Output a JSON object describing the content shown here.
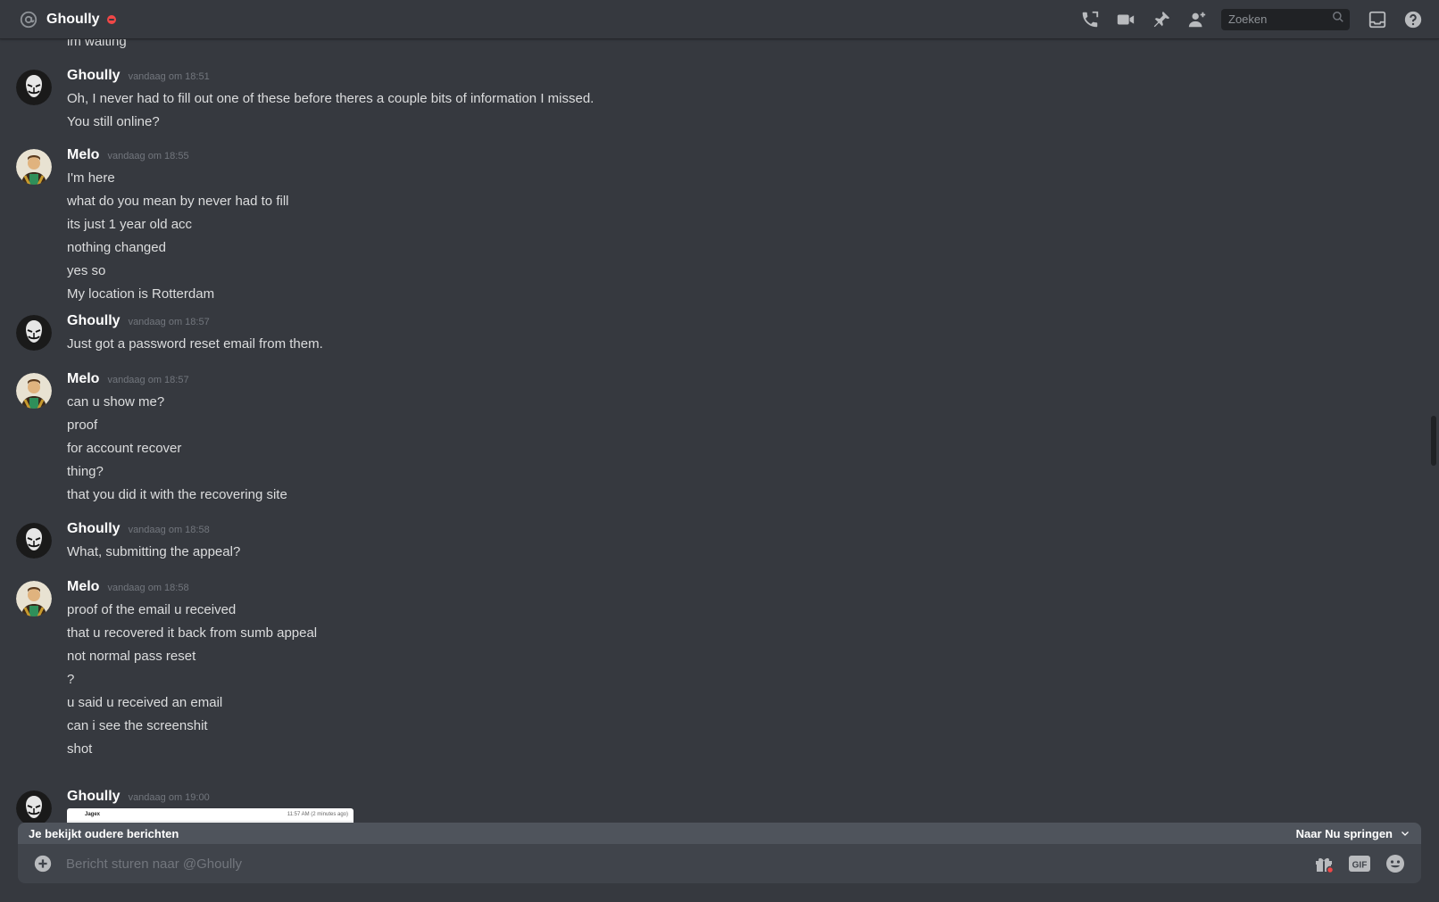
{
  "header": {
    "channel_name": "Ghoully",
    "status": "dnd",
    "search_placeholder": "Zoeken"
  },
  "icons": [
    "at-sign-icon",
    "phone-call-icon",
    "video-call-icon",
    "pin-icon",
    "add-friend-icon",
    "search-icon",
    "inbox-icon",
    "help-icon",
    "plus-circle-icon",
    "gift-icon",
    "gif-icon",
    "emoji-icon",
    "chevron-down-icon"
  ],
  "colors": {
    "background": "#36393f",
    "composer": "#40444b",
    "status_dnd": "#f04747",
    "banner": "#4f545c"
  },
  "messages": {
    "previous_line": "im waiting",
    "groups": [
      {
        "author": "Ghoully",
        "timestamp": "vandaag om 18:51",
        "lines": [
          "Oh, I never had to fill out one of these before theres a couple bits of information I missed.",
          "You still online?"
        ]
      },
      {
        "author": "Melo",
        "timestamp": "vandaag om 18:55",
        "lines": [
          "I'm here",
          "what do you mean by never had to fill",
          "its just 1 year old acc",
          "nothing changed",
          "yes so",
          "My location is Rotterdam"
        ]
      },
      {
        "author": "Ghoully",
        "timestamp": "vandaag om 18:57",
        "lines": [
          "Just got a password reset email from them."
        ]
      },
      {
        "author": "Melo",
        "timestamp": "vandaag om 18:57",
        "lines": [
          "can u show me?",
          "proof",
          "for account recover",
          "thing?",
          "that you did it with the recovering site"
        ]
      },
      {
        "author": "Ghoully",
        "timestamp": "vandaag om 18:58",
        "lines": [
          "What, submitting the appeal?"
        ]
      },
      {
        "author": "Melo",
        "timestamp": "vandaag om 18:58",
        "lines": [
          "proof of the email u received",
          "that u recovered it back from sumb appeal",
          "not normal pass reset",
          "?",
          "u said u received an email",
          "can i see the screenshit",
          "shot"
        ]
      },
      {
        "author": "Ghoully",
        "timestamp": "vandaag om 19:00",
        "attachment": {
          "sender": "Jagex",
          "time": "11:57 AM (2 minutes ago)"
        }
      }
    ]
  },
  "older_banner": {
    "text": "Je bekijkt oudere berichten",
    "jump_label": "Naar Nu springen"
  },
  "composer": {
    "placeholder": "Bericht sturen naar @Ghoully",
    "gif_label": "GIF"
  }
}
